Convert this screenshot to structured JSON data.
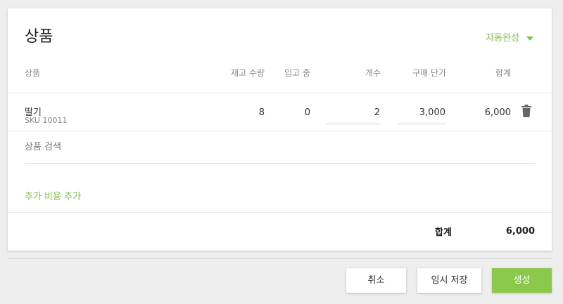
{
  "card": {
    "title": "상품",
    "autocomplete_label": "자동완성",
    "columns": {
      "product": "상품",
      "stock_qty": "재고 수량",
      "incoming": "입고 중",
      "count": "개수",
      "unit_price": "구매 단가",
      "total": "합계"
    },
    "row": {
      "name": "딸기",
      "sku": "SKU 10011",
      "stock_qty": "8",
      "incoming": "0",
      "count": "2",
      "unit_price": "3,000",
      "total": "6,000"
    },
    "search_placeholder": "상품 검색",
    "add_cost_label": "추가 비용 추가",
    "summary": {
      "label": "합계",
      "value": "6,000"
    }
  },
  "footer": {
    "cancel_label": "취소",
    "save_draft_label": "임시 저장",
    "create_label": "생성"
  },
  "colors": {
    "accent": "#7cc14a",
    "primary_button": "#8cc84b"
  },
  "icons": {
    "autocomplete": "chevron-down-icon",
    "delete": "trash-icon"
  }
}
